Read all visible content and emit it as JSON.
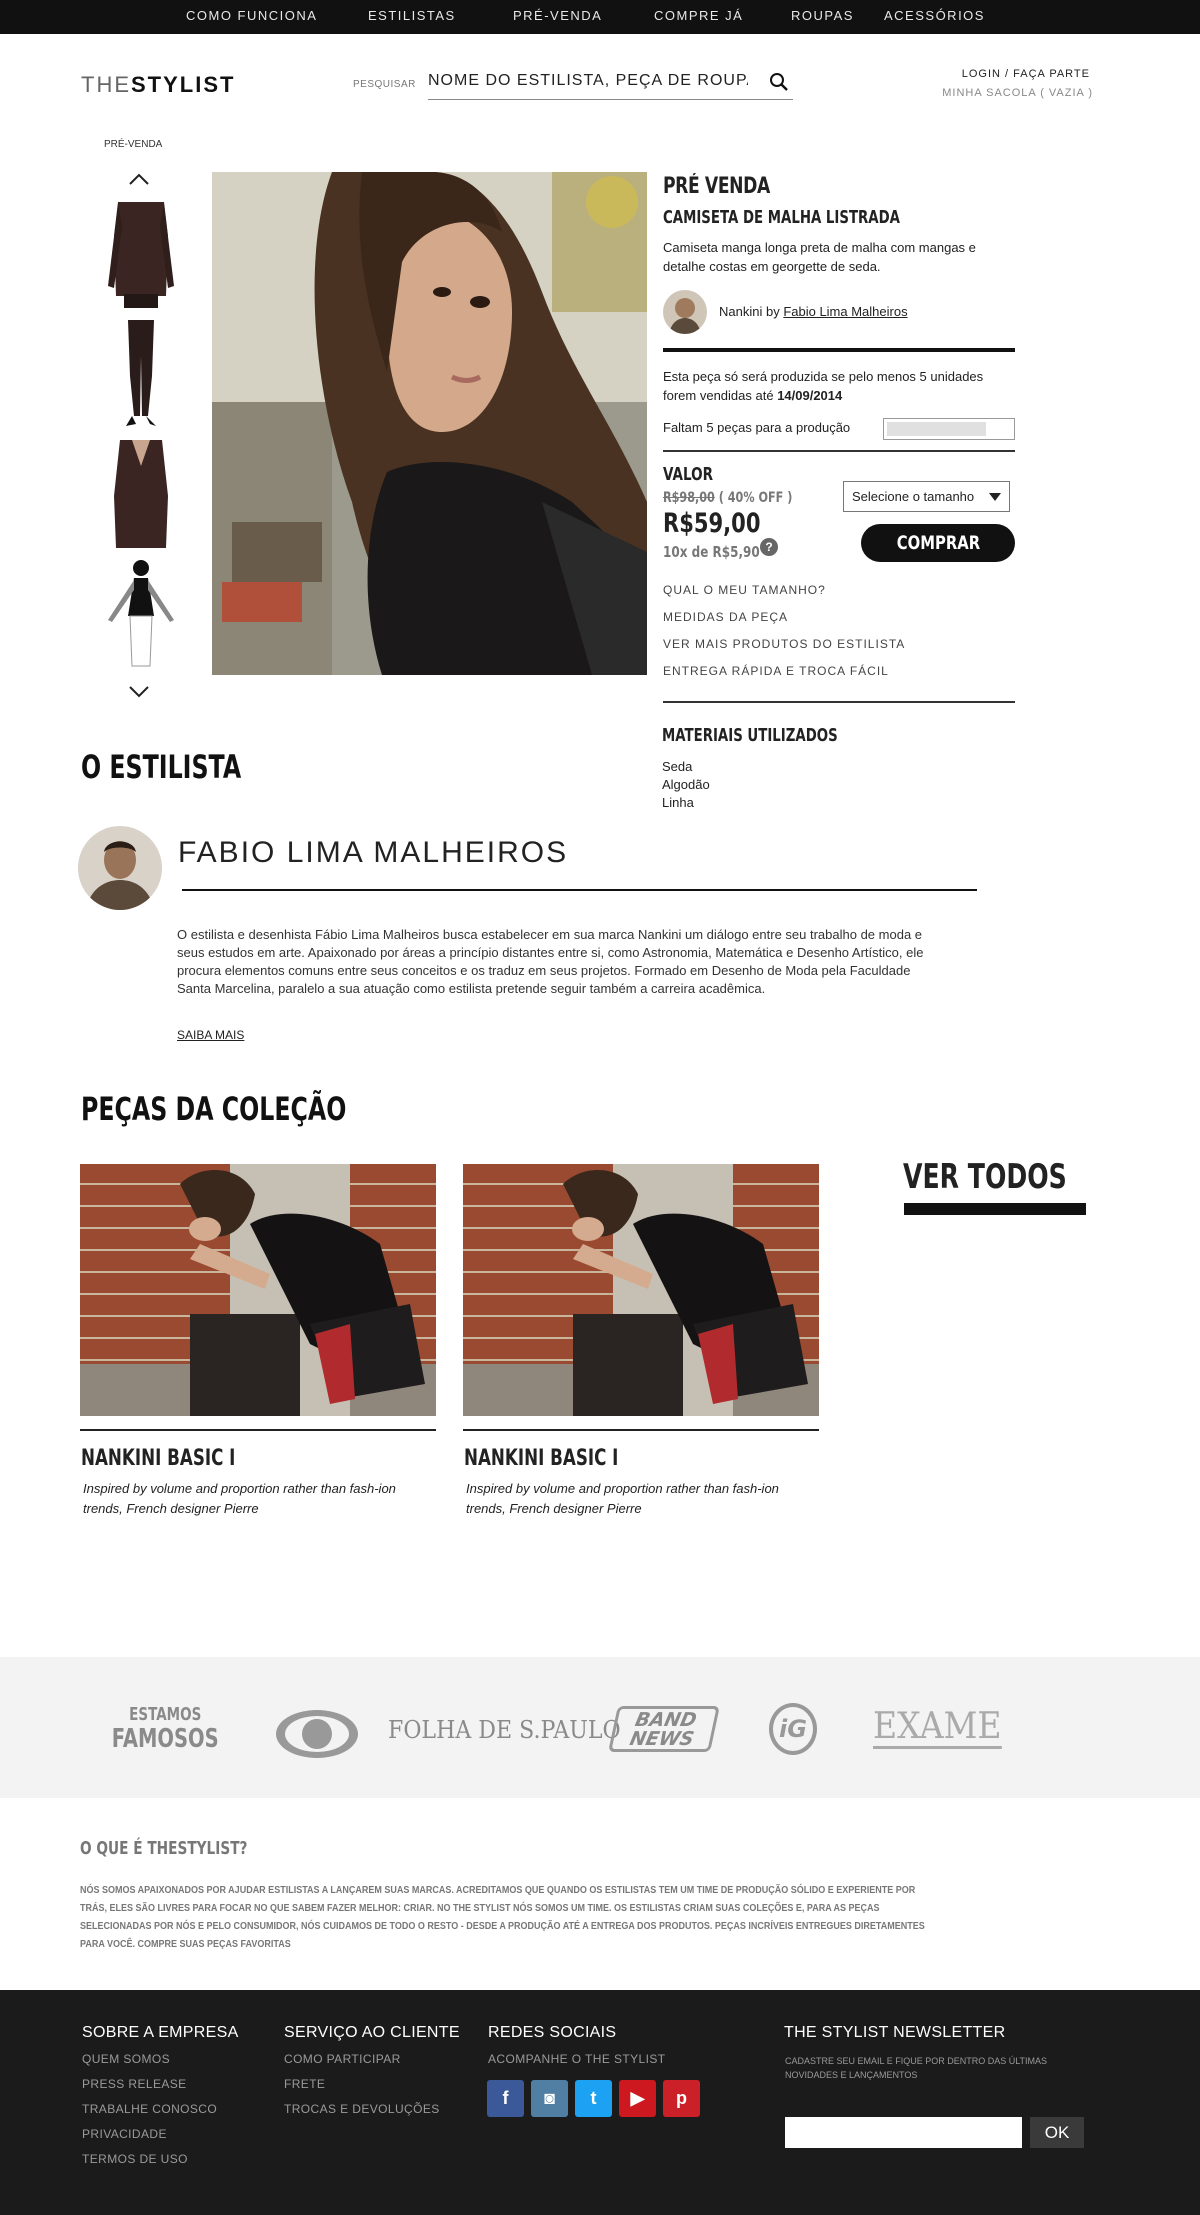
{
  "topnav": {
    "items": [
      "COMO FUNCIONA",
      "ESTILISTAS",
      "PRÉ-VENDA",
      "COMPRE JÁ",
      "ROUPAS",
      "ACESSÓRIOS"
    ]
  },
  "header": {
    "logo_light": "THE",
    "logo_bold": "STYLIST",
    "search_label": "PESQUISAR",
    "search_placeholder": "NOME DO ESTILISTA, PEÇA DE ROUPA",
    "login": "LOGIN / FAÇA PARTE",
    "bag": "MINHA SACOLA ( VAZIA )"
  },
  "gallery": {
    "label": "PRÉ-VENDA"
  },
  "product": {
    "heading": "PRÉ VENDA",
    "name": "CAMISETA DE MALHA LISTRADA",
    "description": "Camiseta manga longa preta de malha com mangas e detalhe costas em georgette de seda.",
    "brand_prefix": "Nankini by ",
    "designer": "Fabio Lima Malheiros",
    "notice_text": "Esta peça só será produzida se pelo menos 5 unidades forem vendidas até ",
    "notice_date": "14/09/2014",
    "remaining": "Faltam 5 peças para a produção",
    "progress_fraction": 0.8,
    "value_label": "VALOR",
    "old_price": "R$98,00",
    "discount": " ( 40% OFF )",
    "price": "R$59,00",
    "installments": "10x de R$5,90",
    "help": "?",
    "size_select": "Selecione o tamanho",
    "buy": "COMPRAR",
    "links": [
      "QUAL O MEU TAMANHO?",
      "MEDIDAS DA PEÇA",
      "VER MAIS PRODUTOS DO ESTILISTA",
      "ENTREGA RÁPIDA E TROCA FÁCIL"
    ],
    "materials_title": "MATERIAIS UTILIZADOS",
    "materials": [
      "Seda",
      "Algodão",
      "Linha"
    ]
  },
  "stylist": {
    "section_title": "O ESTILISTA",
    "name": "FABIO LIMA MALHEIROS",
    "bio": "O estilista e desenhista Fábio Lima Malheiros busca estabelecer em sua marca Nankini um diálogo entre seu trabalho de moda e seus estudos em arte. Apaixonado por áreas a princípio distantes entre si, como Astronomia, Matemática e Desenho Artístico, ele procura elementos comuns entre seus conceitos e os traduz em seus projetos. Formado em Desenho de Moda pela Faculdade Santa Marcelina, paralelo a sua atuação como estilista pretende seguir também a carreira acadêmica.",
    "more": "SAIBA MAIS"
  },
  "collection": {
    "title": "PEÇAS DA COLEÇÃO",
    "see_all": "VER TODOS",
    "items": [
      {
        "title": "NANKINI BASIC I",
        "desc": "Inspired by volume and proportion rather than fash-ion trends, French designer Pierre"
      },
      {
        "title": "NANKINI BASIC I",
        "desc": "Inspired by volume and proportion rather than fash-ion trends, French designer Pierre"
      }
    ]
  },
  "famous": {
    "title_l1": "ESTAMOS",
    "title_l2": "FAMOSOS",
    "logos": [
      "FOLHA DE S.PAULO",
      "BAND",
      "NEWS",
      "iG",
      "EXAME"
    ]
  },
  "about": {
    "title": "O QUE É THESTYLIST?",
    "text": "NÓS SOMOS APAIXONADOS POR AJUDAR ESTILISTAS A LANÇAREM SUAS MARCAS. ACREDITAMOS QUE QUANDO OS ESTILISTAS TEM UM TIME DE PRODUÇÃO SÓLIDO E EXPERIENTE POR TRÁS, ELES SÃO LIVRES PARA FOCAR NO QUE SABEM FAZER MELHOR: CRIAR. NO THE STYLIST NÓS SOMOS UM TIME. OS ESTILISTAS CRIAM SUAS COLEÇÕES E, PARA AS PEÇAS SELECIONADAS POR NÓS E PELO CONSUMIDOR, NÓS CUIDAMOS DE TODO O RESTO - DESDE A PRODUÇÃO ATÉ A ENTREGA DOS PRODUTOS. PEÇAS INCRÍVEIS ENTREGUES DIRETAMENTES PARA VOCÊ. COMPRE SUAS PEÇAS FAVORITAS"
  },
  "footer": {
    "company_title": "SOBRE A EMPRESA",
    "company_links": [
      "QUEM SOMOS",
      "PRESS RELEASE",
      "TRABALHE CONOSCO",
      "PRIVACIDADE",
      "TERMOS DE USO"
    ],
    "service_title": "SERVIÇO AO CLIENTE",
    "service_links": [
      "COMO PARTICIPAR",
      "FRETE",
      "TROCAS E DEVOLUÇÕES"
    ],
    "social_title": "REDES SOCIAIS",
    "social_sub": "ACOMPANHE O THE STYLIST",
    "social_icons": [
      {
        "name": "facebook-icon",
        "glyph": "f",
        "color": "#3b5998"
      },
      {
        "name": "instagram-icon",
        "glyph": "◙",
        "color": "#517fa4"
      },
      {
        "name": "twitter-icon",
        "glyph": "t",
        "color": "#1da1f2"
      },
      {
        "name": "youtube-icon",
        "glyph": "▶",
        "color": "#cc181e"
      },
      {
        "name": "pinterest-icon",
        "glyph": "p",
        "color": "#cb2027"
      }
    ],
    "newsletter_title": "THE STYLIST NEWSLETTER",
    "newsletter_sub": "CADASTRE SEU EMAIL E FIQUE POR DENTRO DAS ÚLTIMAS NOVIDADES E LANÇAMENTOS",
    "newsletter_button": "OK"
  },
  "colors": {
    "nav_bg": "#111111",
    "footer_bg": "#1b1b1b",
    "famous_bg": "#f3f3f3"
  }
}
